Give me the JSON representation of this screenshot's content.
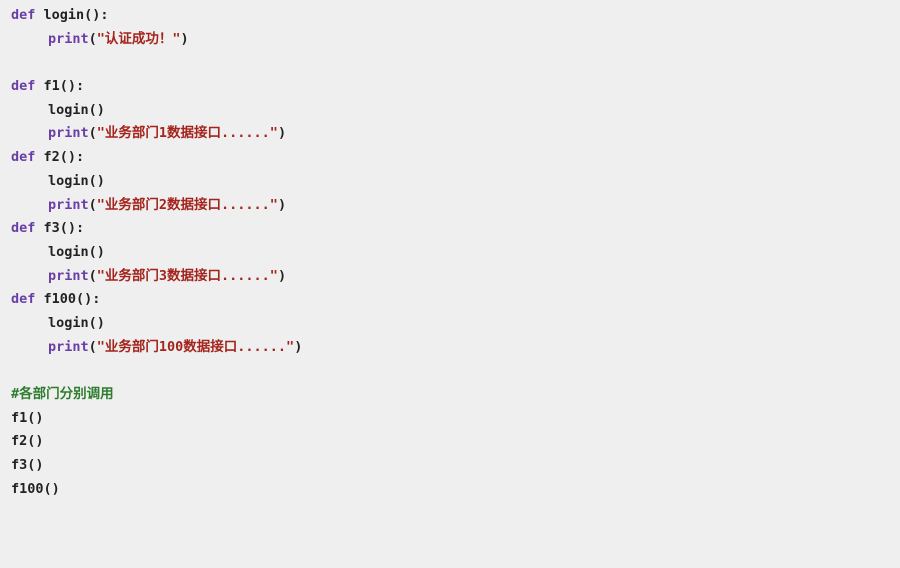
{
  "colors": {
    "background": "#efefef",
    "keyword": "#6a3ea6",
    "string": "#a3241c",
    "comment": "#2e7d2e",
    "text": "#222222"
  },
  "code": {
    "def_kw": "def",
    "print_fn": "print",
    "login_def": " login():",
    "login_print_open": "(",
    "login_print_str": "\"认证成功！\"",
    "login_print_close": ")",
    "f1_def": " f1():",
    "f1_login_call": "login()",
    "f1_print_str": "\"业务部门1数据接口......\"",
    "f2_def": " f2():",
    "f2_login_call": "login()",
    "f2_print_str": "\"业务部门2数据接口......\"",
    "f3_def": " f3():",
    "f3_login_call": "login()",
    "f3_print_str": "\"业务部门3数据接口......\"",
    "f100_def": " f100():",
    "f100_login_call": "login()",
    "f100_print_str": "\"业务部门100数据接口......\"",
    "paren_open": "(",
    "paren_close": ")",
    "comment": "#各部门分别调用",
    "call_f1": "f1()",
    "call_f2": "f2()",
    "call_f3": "f3()",
    "call_f100": "f100()"
  }
}
